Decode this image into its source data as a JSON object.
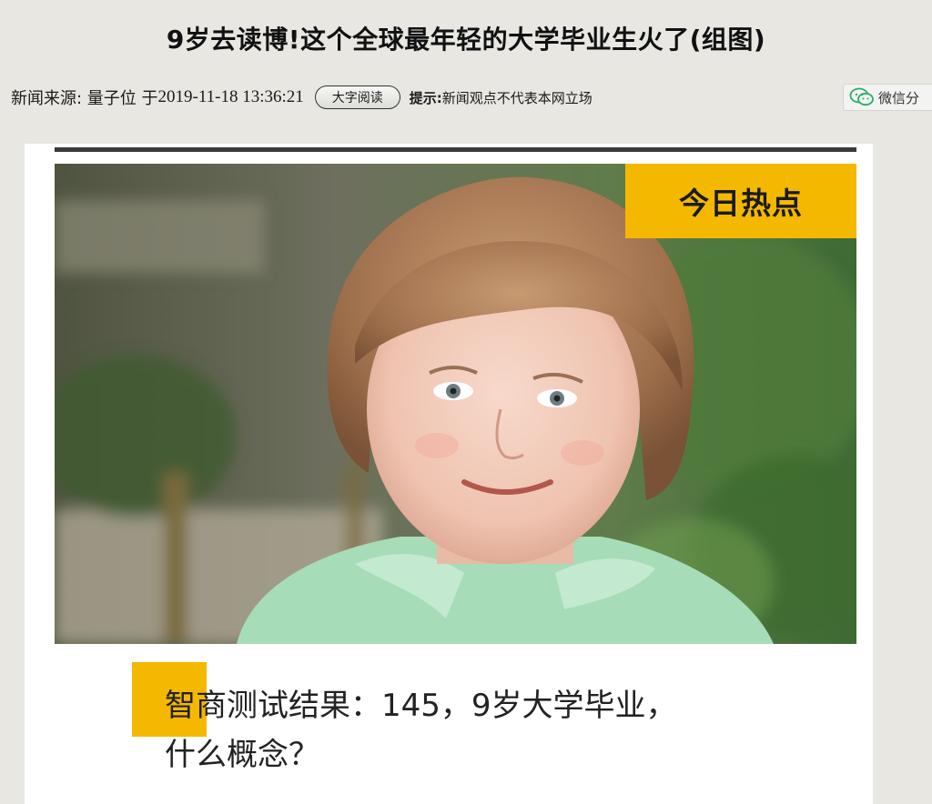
{
  "article": {
    "title": "9岁去读博!这个全球最年轻的大学毕业生火了(组图)",
    "source_label": "新闻来源: 量子位 于",
    "datetime": "2019-11-18 13:36:21",
    "big_font_button": "大字阅读",
    "tip_label": "提示:",
    "tip_text": "新闻观点不代表本网立场",
    "share_label": "微信分"
  },
  "image": {
    "badge_text": "今日热点",
    "caption_line1": "智商测试结果：145，9岁大学毕业，",
    "caption_line2": "什么概念？"
  },
  "colors": {
    "accent": "#f5b800",
    "page_bg": "#e8e7e2",
    "wechat_green": "#2aae67"
  }
}
